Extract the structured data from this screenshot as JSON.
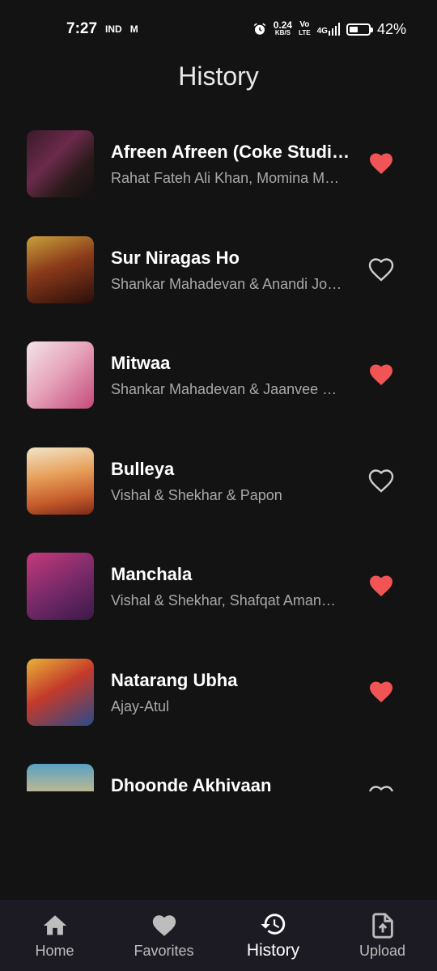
{
  "status_bar": {
    "time": "7:27",
    "carrier_icons": "IND",
    "mail_icon": "M",
    "speed_value": "0.24",
    "speed_unit": "KB/S",
    "vo": "Vo",
    "lte": "LTE",
    "network": "4G",
    "battery": "42%",
    "battery_level": 0.42
  },
  "header": {
    "title": "History"
  },
  "songs": [
    {
      "title": "Afreen Afreen (Coke Studi…",
      "artist": "Rahat Fateh Ali Khan, Momina M…",
      "liked": true,
      "art": "art-1"
    },
    {
      "title": "Sur Niragas Ho",
      "artist": "Shankar Mahadevan & Anandi Jo…",
      "liked": false,
      "art": "art-2"
    },
    {
      "title": "Mitwaa",
      "artist": "Shankar Mahadevan & Jaanvee …",
      "liked": true,
      "art": "art-3"
    },
    {
      "title": "Bulleya",
      "artist": "Vishal & Shekhar & Papon",
      "liked": false,
      "art": "art-4"
    },
    {
      "title": "Manchala",
      "artist": "Vishal & Shekhar, Shafqat Aman…",
      "liked": true,
      "art": "art-5"
    },
    {
      "title": "Natarang Ubha",
      "artist": "Ajay-Atul",
      "liked": true,
      "art": "art-6"
    },
    {
      "title": "Dhoonde Akhivaan",
      "artist": "",
      "liked": false,
      "art": "art-7"
    }
  ],
  "nav": [
    {
      "label": "Home",
      "icon": "home-icon",
      "active": false
    },
    {
      "label": "Favorites",
      "icon": "heart-icon",
      "active": false
    },
    {
      "label": "History",
      "icon": "history-icon",
      "active": true
    },
    {
      "label": "Upload",
      "icon": "upload-icon",
      "active": false
    }
  ],
  "colors": {
    "background": "#131313",
    "heart_liked": "#f05454",
    "nav_background": "#1c1b24",
    "subtitle": "#a9a9a9"
  }
}
